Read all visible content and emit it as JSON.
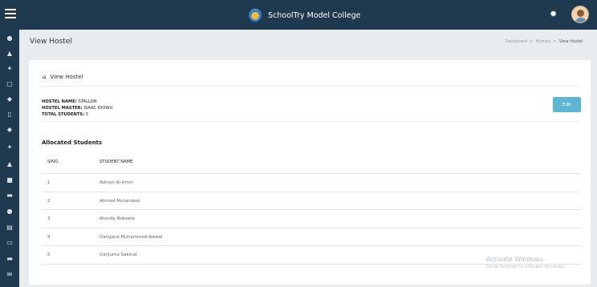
{
  "app": {
    "name": "SchoolTry Model College"
  },
  "icons": {
    "menu": "hamburger-menu-icon",
    "settings": "gear-icon",
    "home": "home-icon"
  },
  "sidebar": {
    "icons": [
      "dashboard-icon",
      "user-icon",
      "users-icon",
      "lock-icon",
      "tag-icon",
      "document-icon",
      "tag-icon",
      "users-group-icon",
      "user-single-icon",
      "file-icon",
      "card-icon",
      "circle-icon",
      "report-icon",
      "monitor-icon",
      "minus-icon",
      "mail-icon"
    ]
  },
  "page": {
    "title": "View Hostel",
    "breadcrumb": [
      "Dashboard",
      "Hostels",
      "View Hostel"
    ],
    "breadcrumb_sep": ">"
  },
  "card": {
    "title": "View Hostel",
    "edit_label": "Edit"
  },
  "hostel": {
    "name_label": "HOSTEL NAME:",
    "name": "STALLON",
    "master_label": "HOSTEL MASTER:",
    "master": "ISAAC IDOWU",
    "total_label": "TOTAL STUDENTS:",
    "total": "5"
  },
  "students": {
    "title": "Allocated Students",
    "columns": [
      "S/NO.",
      "STUDENT NAME"
    ],
    "rows": [
      [
        "1",
        "Adnayi Al-Amin"
      ],
      [
        "2",
        "Ahmed Mutandeel"
      ],
      [
        "3",
        "Atunda Nobeele"
      ],
      [
        "4",
        "Dangana Muhammed-Awwal"
      ],
      [
        "5",
        "Danjuma Sakinat"
      ]
    ]
  },
  "watermark": {
    "line1": "Activate Windows",
    "line2": "Go to Settings to activate Windows."
  }
}
